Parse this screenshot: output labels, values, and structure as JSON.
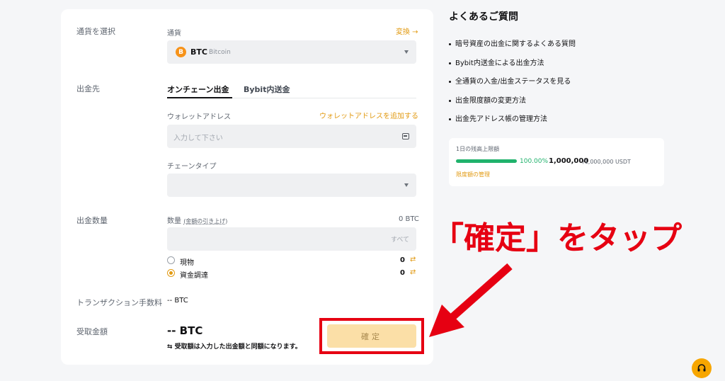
{
  "form": {
    "currency_section": "通貨を選択",
    "currency_label": "通貨",
    "convert_link": "変換",
    "coin_symbol_icon": "B",
    "coin_name": "BTC",
    "coin_fullname": "Bitcoin",
    "destination_section": "出金先",
    "tabs": [
      "オンチェーン出金",
      "Bybit内送金"
    ],
    "wallet_label": "ウォレットアドレス",
    "wallet_add_link": "ウォレットアドレスを追加する",
    "wallet_placeholder": "入力して下さい",
    "chain_label": "チェーンタイプ",
    "amount_section": "出金数量",
    "amount_label": "数量",
    "amount_sub": "(金額の引き上げ)",
    "amount_balance": "0 BTC",
    "amount_all": "すべて",
    "accounts": [
      {
        "label": "現物",
        "value": "0",
        "checked": false
      },
      {
        "label": "資金調達",
        "value": "0",
        "checked": true
      }
    ],
    "fee_section": "トランザクション手数料",
    "fee_value": "-- BTC",
    "receive_section": "受取金額",
    "receive_value": "-- BTC",
    "receive_note": "⇆ 受取額は入力した出金額と同額になります。",
    "confirm_button": "確定"
  },
  "annotation": {
    "callout_text": "「確定」をタップ",
    "color": "#e60012"
  },
  "faq": {
    "title": "よくあるご質問",
    "items": [
      "暗号資産の出金に関するよくある質問",
      "Bybit内送金による出金方法",
      "全通貨の入金/出金ステータスを見る",
      "出金限度額の変更方法",
      "出金先アドレス帳の管理方法"
    ]
  },
  "limit": {
    "label": "1日の残高上限額",
    "percent_text": "100.00%",
    "fill_fraction": 1.0,
    "amount": "1,000,000",
    "total": "/1,000,000 USDT",
    "manage_link": "限度額の管理"
  },
  "colors": {
    "accent": "#e29b14",
    "progress": "#20b26c",
    "support": "#f7a600"
  },
  "icons": {
    "support": "headset-icon",
    "wallet": "address-book-icon"
  }
}
